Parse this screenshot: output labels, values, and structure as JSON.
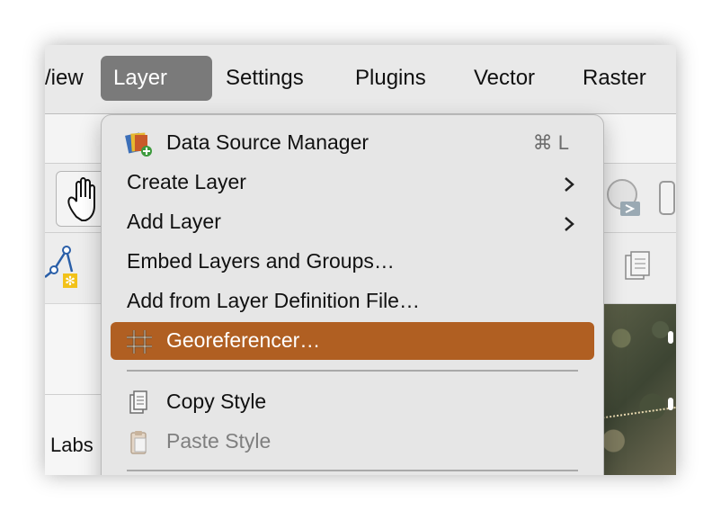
{
  "menubar": {
    "items": [
      {
        "label": "View",
        "display": "/iew"
      },
      {
        "label": "Layer"
      },
      {
        "label": "Settings"
      },
      {
        "label": "Plugins"
      },
      {
        "label": "Vector"
      },
      {
        "label": "Raster"
      }
    ],
    "active_item": "Layer"
  },
  "left_panel": {
    "labs_text": "Labs"
  },
  "layer_menu": {
    "items": [
      {
        "label": "Data Source Manager",
        "shortcut": "⌘ L",
        "icon": "data-source-manager-icon"
      },
      {
        "label": "Create Layer",
        "submenu": true
      },
      {
        "label": "Add Layer",
        "submenu": true
      },
      {
        "label": "Embed Layers and Groups…"
      },
      {
        "label": "Add from Layer Definition File…"
      },
      {
        "label": "Georeferencer…",
        "icon": "georeferencer-grid-icon",
        "highlighted": true
      },
      {
        "label": "Copy Style",
        "icon": "copy-style-icon"
      },
      {
        "label": "Paste Style",
        "icon": "paste-style-icon",
        "disabled": true
      }
    ]
  },
  "colors": {
    "selection_highlight": "#b05f22",
    "menubar_active": "#7a7a7a",
    "menu_background": "#e6e6e6"
  }
}
